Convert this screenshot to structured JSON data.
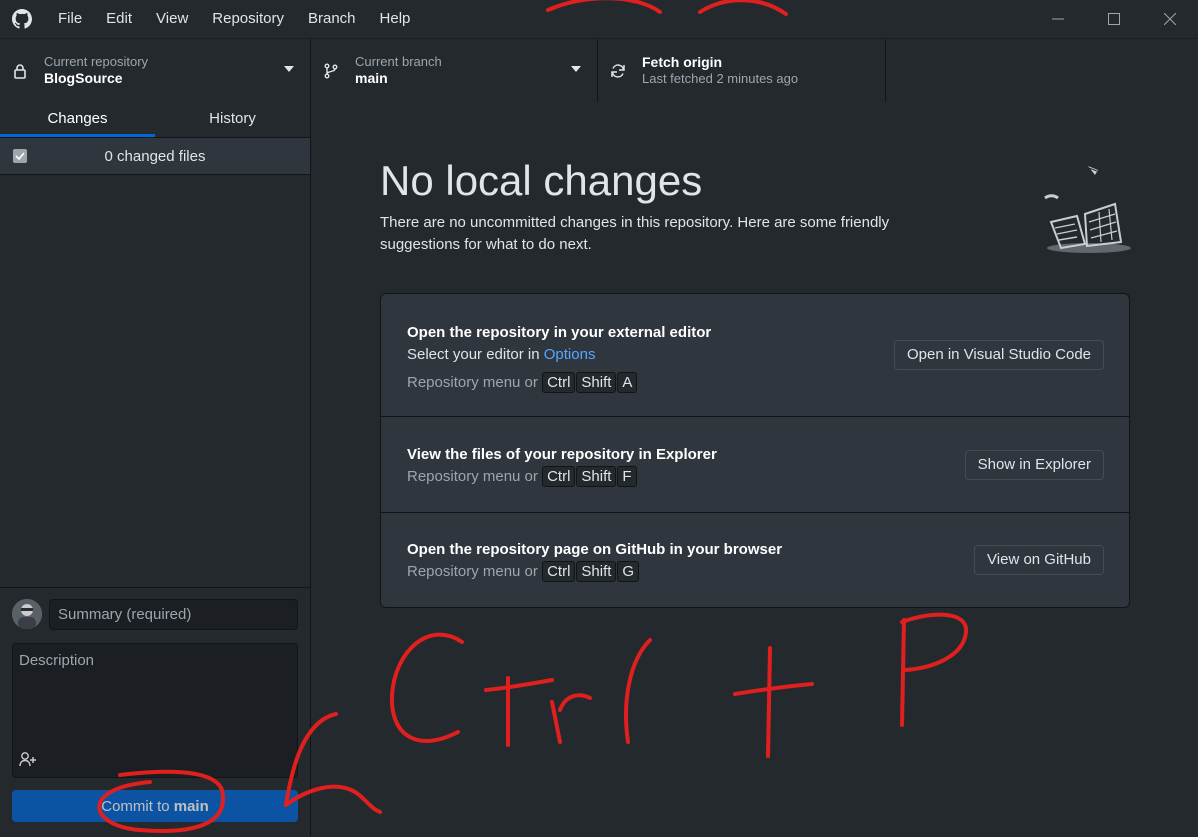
{
  "menu": [
    "File",
    "Edit",
    "View",
    "Repository",
    "Branch",
    "Help"
  ],
  "toolbar": {
    "repo": {
      "label": "Current repository",
      "value": "BlogSource"
    },
    "branch": {
      "label": "Current branch",
      "value": "main"
    },
    "fetch": {
      "label": "Fetch origin",
      "status": "Last fetched 2 minutes ago"
    }
  },
  "sidebar": {
    "tabs": [
      "Changes",
      "History"
    ],
    "active_tab": "Changes",
    "changes_count": "0 changed files",
    "summary_placeholder": "Summary (required)",
    "description_placeholder": "Description",
    "commit_prefix": "Commit to ",
    "commit_branch": "main"
  },
  "blank": {
    "title": "No local changes",
    "description": "There are no uncommitted changes in this repository. Here are some friendly suggestions for what to do next."
  },
  "actions": [
    {
      "title": "Open the repository in your external editor",
      "sub_prefix": "Select your editor in ",
      "sub_link": "Options",
      "hint": "Repository menu or",
      "keys": [
        "Ctrl",
        "Shift",
        "A"
      ],
      "button": "Open in Visual Studio Code"
    },
    {
      "title": "View the files of your repository in Explorer",
      "hint": "Repository menu or",
      "keys": [
        "Ctrl",
        "Shift",
        "F"
      ],
      "button": "Show in Explorer"
    },
    {
      "title": "Open the repository page on GitHub in your browser",
      "hint": "Repository menu or",
      "keys": [
        "Ctrl",
        "Shift",
        "G"
      ],
      "button": "View on GitHub"
    }
  ],
  "annotation": {
    "color": "#e0201e"
  },
  "colors": {
    "background": "#24292e",
    "accent": "#0366d6",
    "link": "#58a6ff"
  }
}
